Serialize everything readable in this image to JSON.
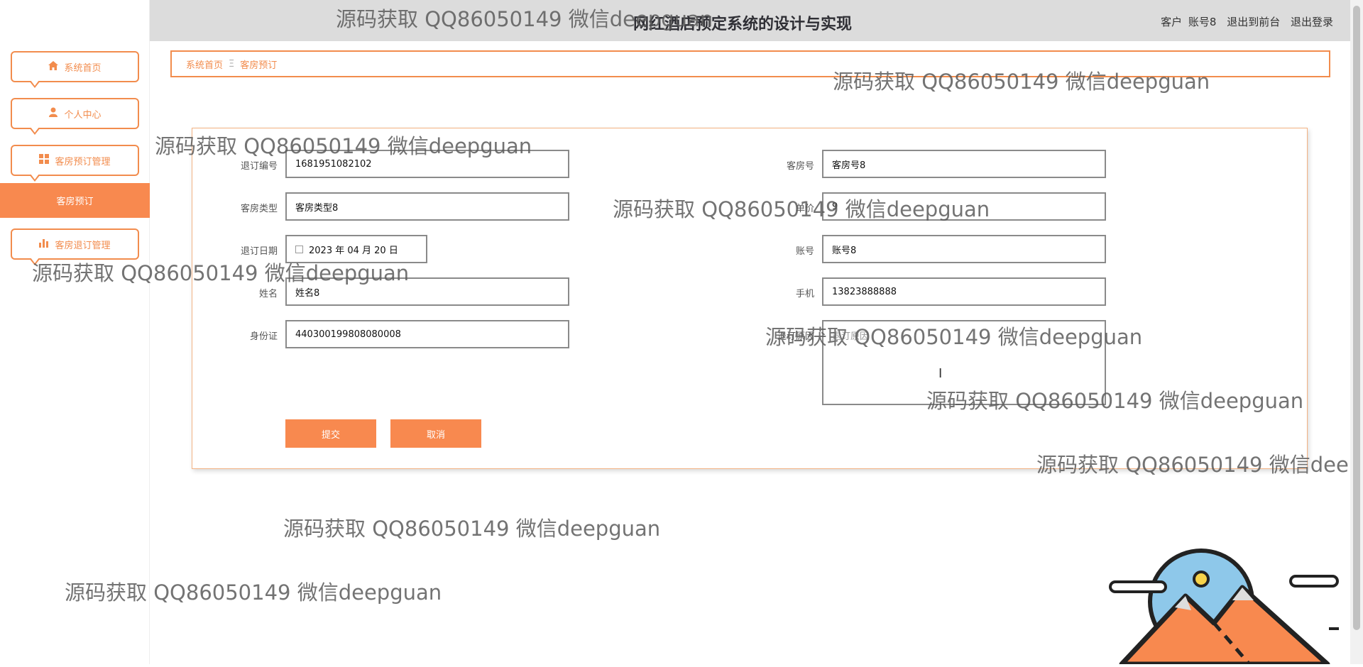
{
  "header": {
    "title": "网红酒店预定系统的设计与实现",
    "links": [
      "客户",
      "账号8",
      "退出到前台",
      "退出登录"
    ]
  },
  "sidebar": {
    "items": [
      {
        "label": "系统首页",
        "icon": "home-icon"
      },
      {
        "label": "个人中心",
        "icon": "user-icon"
      },
      {
        "label": "客房预订管理",
        "icon": "grid-icon"
      },
      {
        "label": "客房退订管理",
        "icon": "bar-chart-icon"
      }
    ],
    "active_sub": "客房预订"
  },
  "breadcrumb": {
    "home": "系统首页",
    "separator": "Ξ",
    "current": "客房预订"
  },
  "form": {
    "left": [
      {
        "label": "退订编号",
        "value": "1681951082102"
      },
      {
        "label": "客房类型",
        "value": "客房类型8"
      },
      {
        "label": "退订日期",
        "value": "2023 年 04 月 20 日"
      },
      {
        "label": "姓名",
        "value": "姓名8"
      },
      {
        "label": "身份证",
        "value": "440300199808080008"
      }
    ],
    "right": [
      {
        "label": "客房号",
        "value": "客房号8"
      },
      {
        "label": "单价",
        "value": "9"
      },
      {
        "label": "账号",
        "value": "账号8"
      },
      {
        "label": "手机",
        "value": "13823888888"
      },
      {
        "label": "退订原因",
        "placeholder": "退订原因"
      }
    ],
    "submit": "提交",
    "cancel": "取消"
  },
  "watermark": "源码获取 QQ86050149 微信deepguan",
  "colors": {
    "accent": "#f8894f",
    "border": "#f28c4d"
  }
}
